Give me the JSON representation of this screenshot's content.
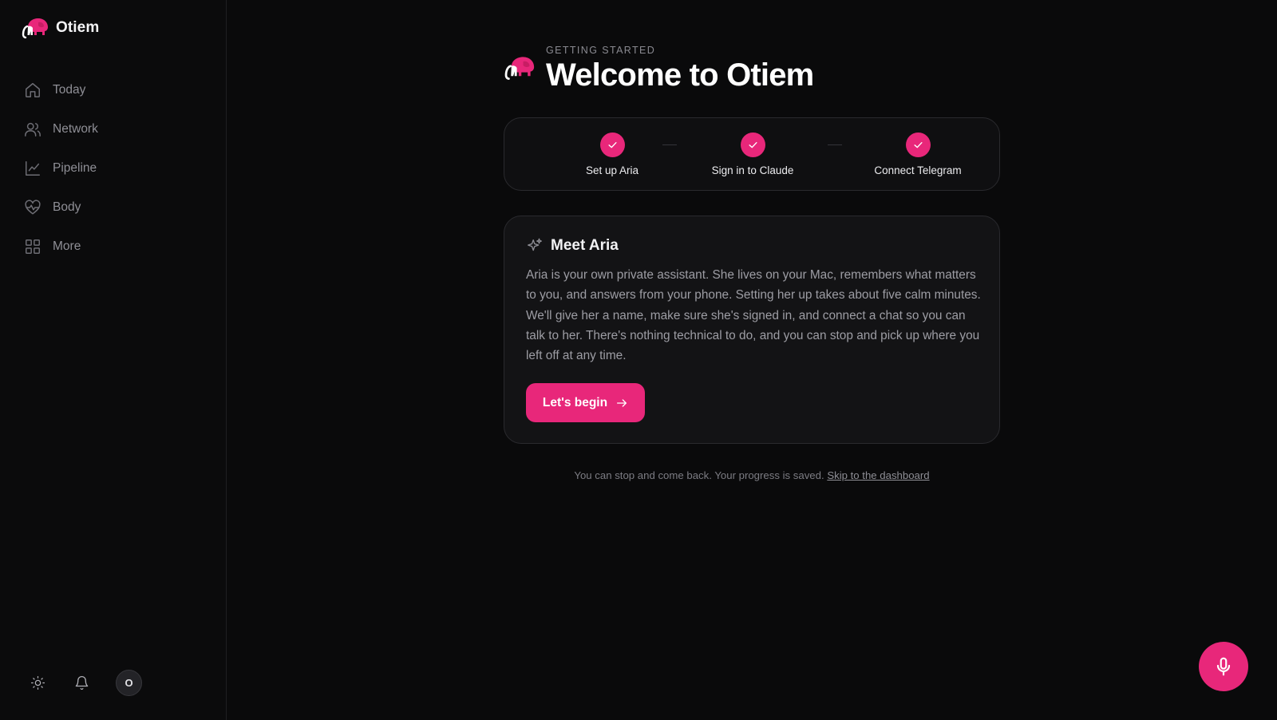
{
  "app": {
    "name": "Otiem",
    "logo_icon": "elephant-logo-icon",
    "accent_color": "#e8277a"
  },
  "sidebar": {
    "items": [
      {
        "label": "Today",
        "icon": "home-icon"
      },
      {
        "label": "Network",
        "icon": "users-icon"
      },
      {
        "label": "Pipeline",
        "icon": "line-chart-icon"
      },
      {
        "label": "Body",
        "icon": "heart-pulse-icon"
      },
      {
        "label": "More",
        "icon": "grid-icon"
      }
    ],
    "footer": {
      "theme_icon": "sun-icon",
      "notifications_icon": "bell-icon",
      "avatar_initial": "O"
    }
  },
  "header": {
    "eyebrow": "GETTING STARTED",
    "title": "Welcome to Otiem"
  },
  "steps": [
    {
      "label": "Set up Aria",
      "status": "complete",
      "icon": "check-icon"
    },
    {
      "label": "Sign in to Claude",
      "status": "complete",
      "icon": "check-icon"
    },
    {
      "label": "Connect Telegram",
      "status": "complete",
      "icon": "check-icon"
    }
  ],
  "card": {
    "icon": "sparkle-icon",
    "title": "Meet Aria",
    "body": "Aria is your own private assistant. She lives on your Mac, remembers what matters to you, and answers from your phone. Setting her up takes about five calm minutes. We'll give her a name, make sure she's signed in, and connect a chat so you can talk to her. There's nothing technical to do, and you can stop and pick up where you left off at any time.",
    "button_label": "Let's begin",
    "button_icon": "arrow-right-icon"
  },
  "footer": {
    "text": "You can stop and come back. Your progress is saved.",
    "link": "Skip to the dashboard"
  },
  "fab": {
    "icon": "microphone-icon"
  }
}
